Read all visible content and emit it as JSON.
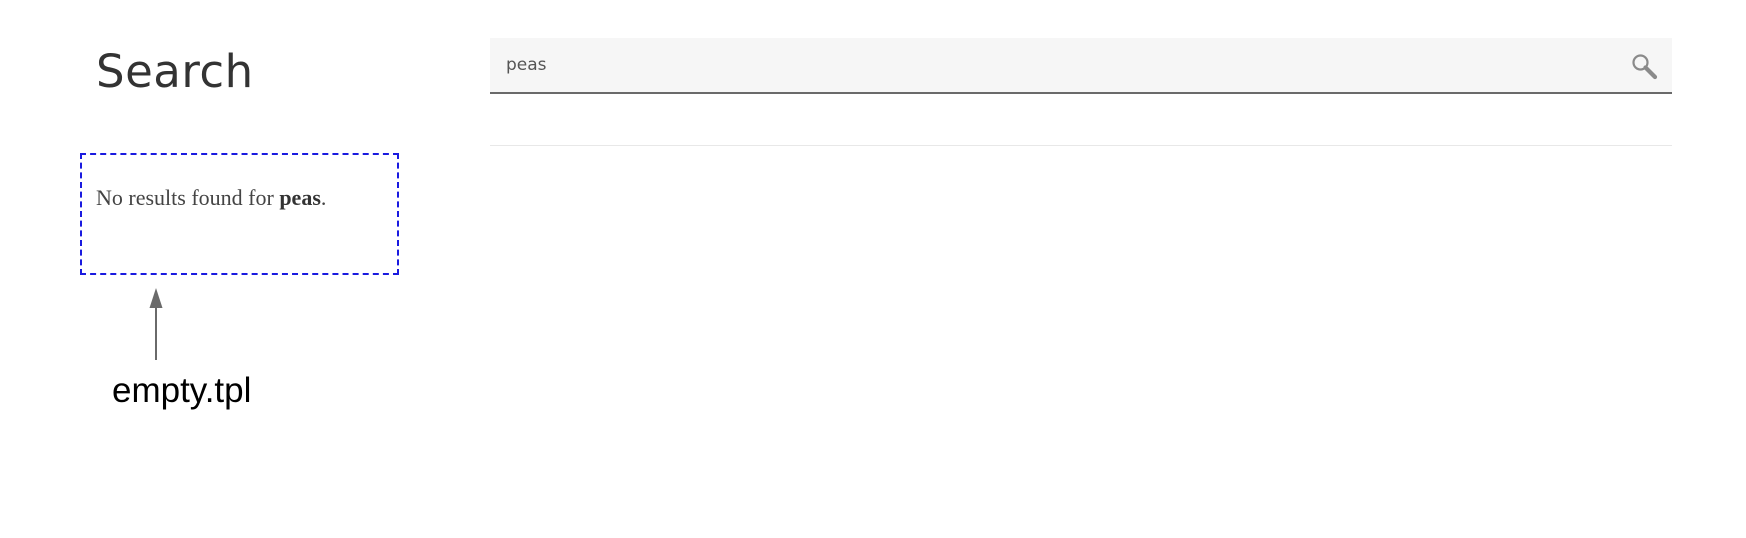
{
  "header": {
    "title": "Search"
  },
  "search": {
    "value": "peas",
    "icon": "search-icon"
  },
  "results": {
    "empty_prefix": "No results found for ",
    "query": "peas",
    "empty_suffix": "."
  },
  "annotation": {
    "label": "empty.tpl",
    "box_color": "#1a1adf",
    "arrow_color": "#6a6a6a"
  }
}
